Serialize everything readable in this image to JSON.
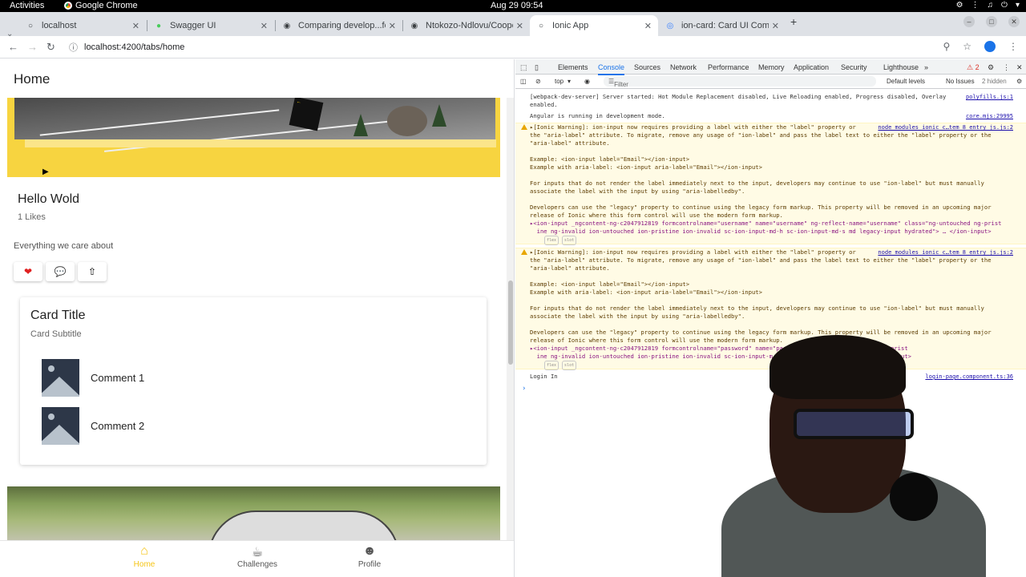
{
  "system_bar": {
    "activities": "Activities",
    "app_name": "Google Chrome",
    "clock": "Aug 29  09:54"
  },
  "browser": {
    "tabs": [
      {
        "title": "localhost",
        "icon": "globe-icon"
      },
      {
        "title": "Swagger UI",
        "icon": "swagger-icon"
      },
      {
        "title": "Comparing develop...fe",
        "icon": "github-icon"
      },
      {
        "title": "Ntokozo-Ndlovu/Cooper",
        "icon": "github-icon"
      },
      {
        "title": "Ionic App",
        "icon": "globe-icon"
      },
      {
        "title": "ion-card: Card UI Compo",
        "icon": "ionic-icon"
      }
    ],
    "active_tab": 4,
    "url": "localhost:4200/tabs/home"
  },
  "app": {
    "header_title": "Home",
    "card1": {
      "title": "Hello Wold",
      "subtitle": "1 Likes",
      "text": "Everything we care about"
    },
    "card2": {
      "title": "Card Title",
      "subtitle": "Card Subtitle",
      "comments": [
        "Comment 1",
        "Comment 2"
      ]
    },
    "tabs": [
      {
        "label": "Home",
        "icon": "home-icon",
        "active": true
      },
      {
        "label": "Challenges",
        "icon": "cup-icon",
        "active": false
      },
      {
        "label": "Profile",
        "icon": "person-icon",
        "active": false
      }
    ],
    "accent_color": "#f5c518"
  },
  "devtools": {
    "tabs": [
      "Elements",
      "Console",
      "Sources",
      "Network",
      "Performance",
      "Memory",
      "Application",
      "Security",
      "Lighthouse"
    ],
    "active_tab": "Console",
    "warning_count": "2",
    "context": "top",
    "filter_placeholder": "Filter",
    "levels": "Default levels",
    "issues": "No Issues",
    "hidden": "2 hidden",
    "logs": {
      "l1": "[webpack-dev-server] Server started: Hot Module Replacement disabled, Live Reloading enabled, Progress disabled, Overlay\nenabled.",
      "l1_src": "polyfills.js:1",
      "l2": "Angular is running in development mode.",
      "l2_src": "core.mjs:29995",
      "w1": "▸[Ionic Warning]: ion-input now requires providing a label with either the \"label\" property or\nthe \"aria-label\" attribute. To migrate, remove any usage of \"ion-label\" and pass the label text to either the \"label\" property or the\n\"aria-label\" attribute.\n\nExample: <ion-input label=\"Email\"></ion-input>\nExample with aria-label: <ion-input aria-label=\"Email\"></ion-input>\n\nFor inputs that do not render the label immediately next to the input, developers may continue to use \"ion-label\" but must manually\nassociate the label with the input by using \"aria-labelledby\".\n\nDevelopers can use the \"legacy\" property to continue using the legacy form markup. This property will be removed in an upcoming major\nrelease of Ionic where this form control will use the modern form markup.",
      "w1_src": "node_modules_ionic_c…tem_8_entry_js.js:2",
      "w1_el": "▸<ion-input _ngcontent-ng-c2047912819 formcontrolname=\"username\" name=\"username\" ng-reflect-name=\"username\" class=\"ng-untouched ng-prist\n  ine ng-invalid ion-untouched ion-pristine ion-invalid sc-ion-input-md-h sc-ion-input-md-s md legacy-input hydrated\"> … </ion-input>",
      "w2": "▸[Ionic Warning]: ion-input now requires providing a label with either the \"label\" property or\nthe \"aria-label\" attribute. To migrate, remove any usage of \"ion-label\" and pass the label text to either the \"label\" property or the\n\"aria-label\" attribute.\n\nExample: <ion-input label=\"Email\"></ion-input>\nExample with aria-label: <ion-input aria-label=\"Email\"></ion-input>\n\nFor inputs that do not render the label immediately next to the input, developers may continue to use \"ion-label\" but must manually\nassociate the label with the input by using \"aria-labelledby\".\n\nDevelopers can use the \"legacy\" property to continue using the legacy form markup. This property will be removed in an upcoming major\nrelease of Ionic where this form control will use the modern form markup.",
      "w2_src": "node_modules_ionic_c…tem_8_entry_js.js:2",
      "w2_el": "▸<ion-input _ngcontent-ng-c2047912819 formcontrolname=\"password\" name=\"password\" class=\"ng-untouched ng-prist\n  ine ng-invalid ion-untouched ion-pristine ion-invalid sc-ion-input-m… legacy-input hydrated\"> … </ion-input>",
      "badge_flex": "flex",
      "badge_slot": "slot",
      "l3": "Login In",
      "l3_src": "login-page.component.ts:36"
    }
  }
}
